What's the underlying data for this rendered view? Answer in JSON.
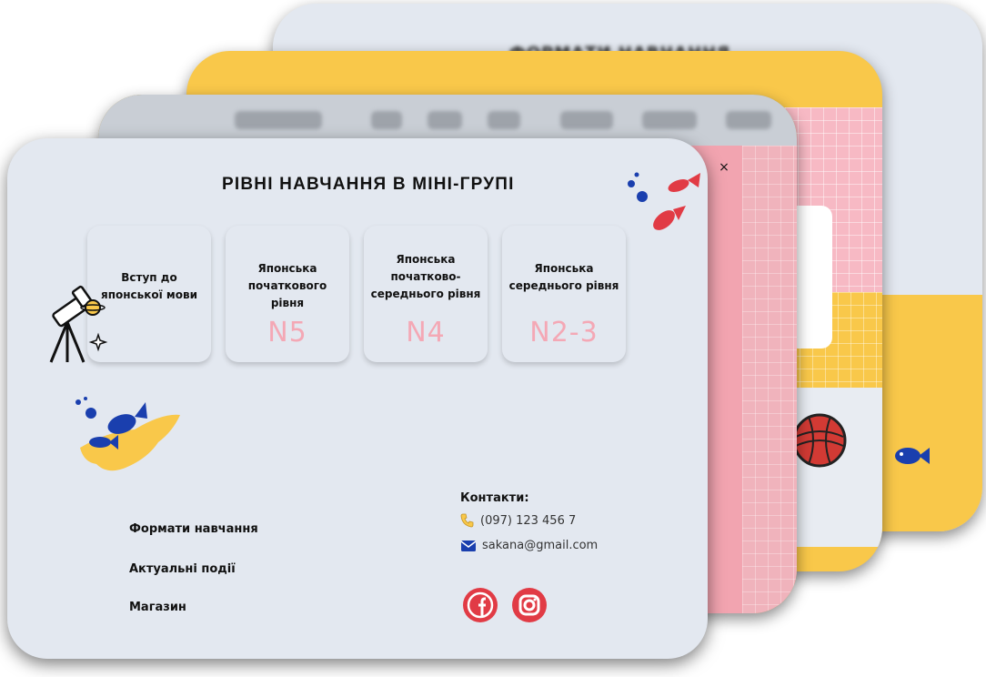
{
  "back_card": {
    "title": "ФОРМАТИ НАВЧАННЯ"
  },
  "modal": {
    "close_label": "×"
  },
  "main": {
    "title": "РІВНІ НАВЧАННЯ В МІНІ-ГРУПІ",
    "levels": [
      {
        "name": "Вступ до японської мови",
        "code": ""
      },
      {
        "name": "Японська початкового рівня",
        "code": "N5"
      },
      {
        "name": "Японська початково-середнього рівня",
        "code": "N4"
      },
      {
        "name": "Японська середнього рівня",
        "code": "N2-3"
      }
    ],
    "footer_links": [
      "Формати навчання",
      "Актуальні події",
      "Магазин"
    ],
    "contacts": {
      "title": "Контакти:",
      "phone": "(097) 123 456 7",
      "email": "sakana@gmail.com"
    }
  },
  "colors": {
    "background_card": "#e3e8f0",
    "accent_pink": "#f4a8b5",
    "accent_red": "#e13b45",
    "accent_yellow": "#f9c84a",
    "accent_blue": "#1a3fae"
  },
  "icons": [
    "close-icon",
    "phone-icon",
    "mail-icon",
    "facebook-icon",
    "instagram-icon",
    "telescope-icon",
    "fish-icon"
  ]
}
